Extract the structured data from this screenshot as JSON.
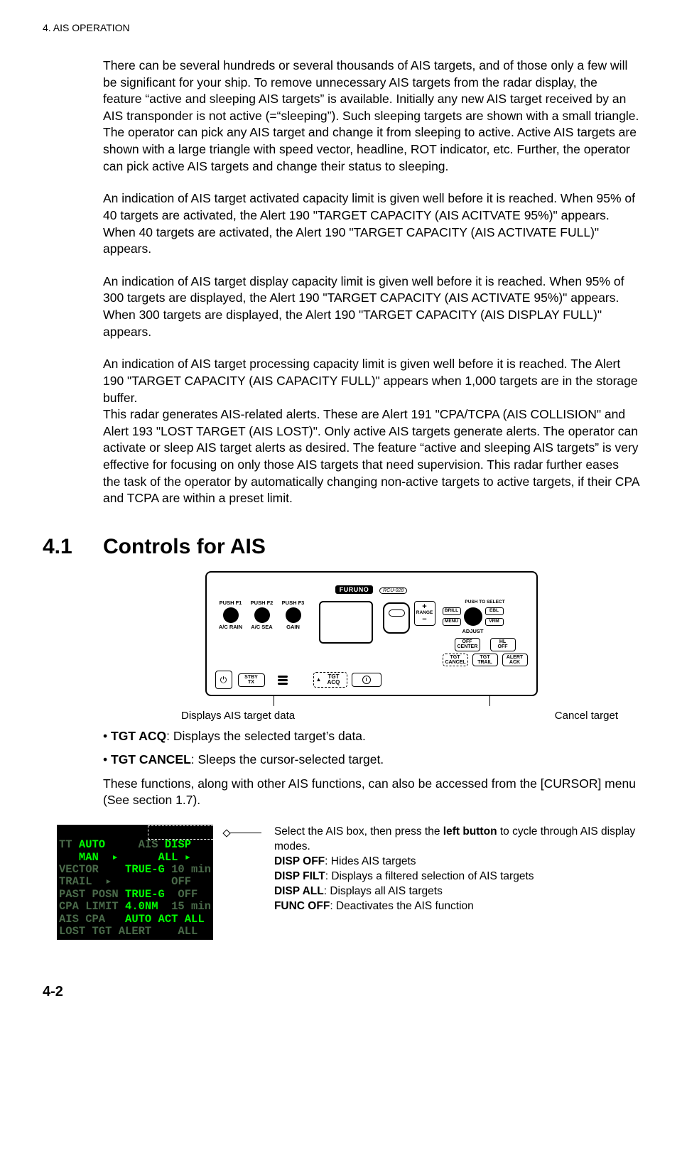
{
  "header": "4.  AIS OPERATION",
  "para1": "There can be several hundreds or several thousands of AIS targets, and of those only a few will be significant for your ship. To remove unnecessary AIS targets from the radar display, the feature “active and sleeping AIS targets” is available. Initially any new AIS target received by an AIS transponder is not active (=“sleeping”). Such sleeping targets are shown with a small triangle. The operator can pick any AIS target and change it from sleeping to active. Active AIS targets are shown with a large triangle with speed vector, headline, ROT indicator, etc. Further, the operator can pick active AIS targets and change their status to sleeping.",
  "para2": "An indication of AIS target activated capacity limit is given well before it is reached. When 95% of 40 targets are activated, the Alert 190 \"TARGET CAPACITY (AIS ACITVATE 95%)\" appears. When 40 targets are activated, the Alert 190 \"TARGET CAPACITY (AIS ACTIVATE FULL)\" appears.",
  "para3": "An indication of AIS target display capacity limit is given well before it is reached. When 95% of 300 targets are displayed, the Alert 190 \"TARGET CAPACITY (AIS ACTIVATE 95%)\" appears. When 300 targets are displayed, the Alert 190 \"TARGET CAPACITY (AIS DISPLAY FULL)\" appears.",
  "para4": "An indication of AIS target processing capacity limit is given well before it is reached. The Alert 190 \"TARGET CAPACITY (AIS CAPACITY FULL)\" appears when 1,000 targets are in the storage buffer.\nThis radar generates AIS-related alerts. These are Alert 191 \"CPA/TCPA (AIS COLLISION\" and Alert 193 \"LOST TARGET (AIS LOST)\". Only active AIS targets generate alerts. The operator can activate or sleep AIS target alerts as desired. The feature “active and sleeping AIS targets” is very effective for focusing on only those AIS targets that need supervision. This radar further eases the task of the operator by automatically changing non-active targets to active targets, if their CPA and TCPA are within a preset limit.",
  "section": {
    "num": "4.1",
    "title": "Controls for AIS"
  },
  "panel": {
    "brand": "FURUNO",
    "model": "RCU-028",
    "knobs": [
      {
        "top": "PUSH  F1",
        "bot": "A/C  RAIN"
      },
      {
        "top": "PUSH  F2",
        "bot": "A/C  SEA"
      },
      {
        "top": "PUSH  F3",
        "bot": "GAIN"
      }
    ],
    "stby": "STBY\nTX",
    "tgt_acq": "TGT  ACQ",
    "range": {
      "plus": "+",
      "label": "RANGE",
      "minus": "−"
    },
    "right_top": "PUSH TO SELECT",
    "right_keys": {
      "brill": "BRILL",
      "menu": "MENU",
      "ebl": "EBL",
      "vrm": "VRM",
      "adjust": "ADJUST"
    },
    "row2": {
      "off": "OFF\nCENTER",
      "hl": "HL\nOFF"
    },
    "row3": {
      "tgtc": "TGT\nCANCEL",
      "tgtt": "TGT\nTRAIL",
      "alert": "ALERT\nACK"
    }
  },
  "captions": {
    "left": "Displays AIS target data",
    "right": "Cancel target"
  },
  "bullets": {
    "b1_bold": "TGT ACQ",
    "b1_rest": ": Displays the selected target’s data.",
    "b2_bold": "TGT CANCEL",
    "b2_rest": ": Sleeps the cursor-selected target."
  },
  "after_bullets": "These functions, along with other AIS functions, can also be accessed from the [CURSOR] menu (See section 1.7).",
  "lcd": {
    "l1a": "TT ",
    "l1b": "AUTO",
    "l1c": "     ",
    "l1d": "AIS ",
    "l1e": "DISP",
    "l2a": "   MAN  ▸      ALL ▸",
    "l3a": "VECTOR    ",
    "l3b": "TRUE-G",
    "l3c": " 10 min",
    "l4a": "TRAIL  ▸         OFF",
    "l5a": "PAST POSN ",
    "l5b": "TRUE-G",
    "l5c": "  OFF",
    "l6a": "CPA LIMIT ",
    "l6b": "4.0NM",
    "l6c": "  15 min",
    "l7a": "AIS CPA   ",
    "l7b": "AUTO ACT ALL",
    "l8a": "LOST TGT ALERT    ALL"
  },
  "lcd_desc": {
    "line1a": "Select the AIS box, then press the ",
    "line1b": "left button",
    "line1c": " to cycle through AIS display modes.",
    "d1b": "DISP OFF",
    "d1r": ": Hides AIS targets",
    "d2b": "DISP FILT",
    "d2r": ": Displays a filtered selection of  AIS targets",
    "d3b": "DISP ALL",
    "d3r": ": Displays all AIS targets",
    "d4b": "FUNC OFF",
    "d4r": ": Deactivates the AIS function"
  },
  "pagenum": "4-2"
}
